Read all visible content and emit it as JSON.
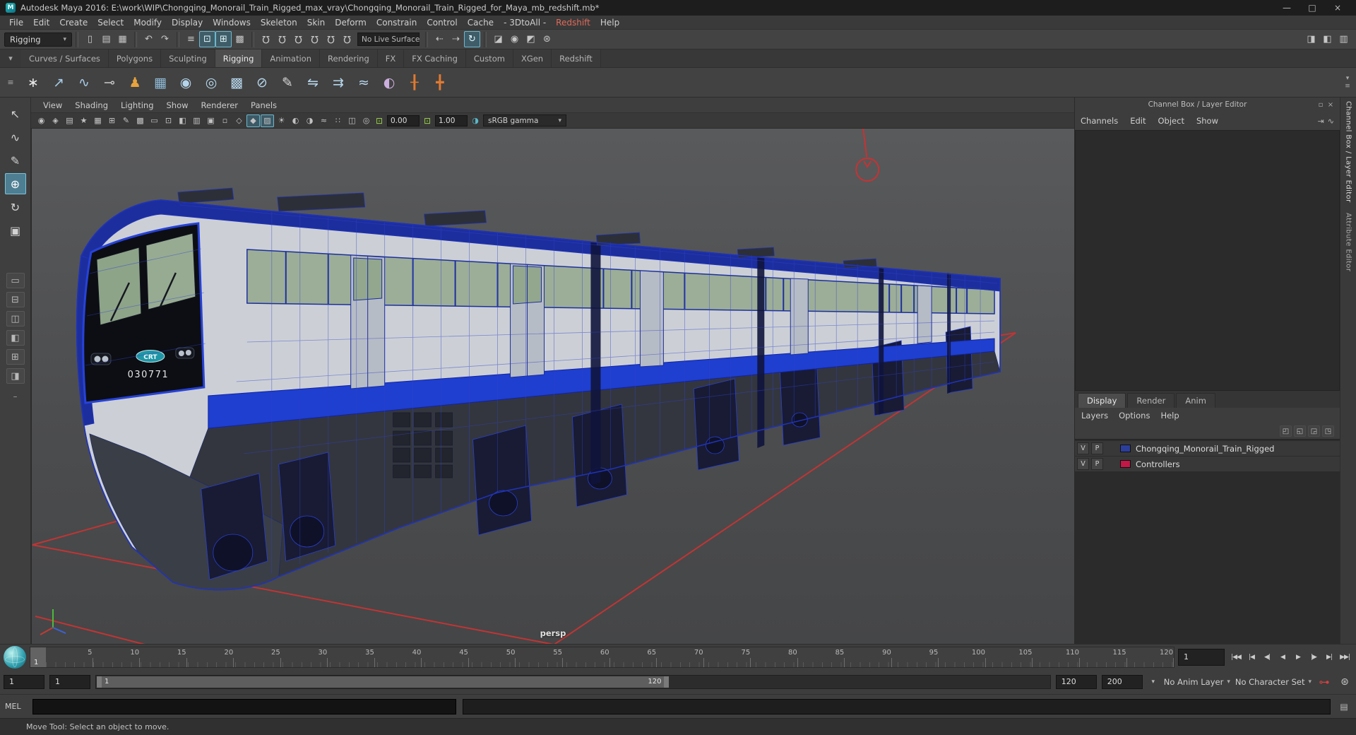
{
  "window": {
    "title": "Autodesk Maya 2016: E:\\work\\WIP\\Chongqing_Monorail_Train_Rigged_max_vray\\Chongqing_Monorail_Train_Rigged_for_Maya_mb_redshift.mb*",
    "logo": "M",
    "minimize": "—",
    "maximize": "□",
    "close": "×"
  },
  "menubar": {
    "items": [
      {
        "label": "File"
      },
      {
        "label": "Edit"
      },
      {
        "label": "Create"
      },
      {
        "label": "Select"
      },
      {
        "label": "Modify"
      },
      {
        "label": "Display"
      },
      {
        "label": "Windows"
      },
      {
        "label": "Skeleton"
      },
      {
        "label": "Skin"
      },
      {
        "label": "Deform"
      },
      {
        "label": "Constrain"
      },
      {
        "label": "Control"
      },
      {
        "label": "Cache"
      },
      {
        "label": "- 3DtoAll -"
      },
      {
        "label": "Redshift",
        "color": "#e06a5a"
      },
      {
        "label": "Help"
      }
    ]
  },
  "toolbar": {
    "menuset": "Rigging",
    "caret": "▾",
    "file_icons": [
      {
        "name": "new-scene-icon",
        "glyph": "▯"
      },
      {
        "name": "open-scene-icon",
        "glyph": "▤"
      },
      {
        "name": "save-scene-icon",
        "glyph": "▦"
      }
    ],
    "undo_icons": [
      {
        "name": "undo-icon",
        "glyph": "↶"
      },
      {
        "name": "redo-icon",
        "glyph": "↷"
      }
    ],
    "select_icons": [
      {
        "name": "select-hierarchy-icon",
        "glyph": "≡"
      },
      {
        "name": "select-object-icon",
        "glyph": "⊡",
        "active": true
      },
      {
        "name": "select-component-icon",
        "glyph": "⊞",
        "active": true
      },
      {
        "name": "select-asset-icon",
        "glyph": "▩"
      }
    ],
    "snap_icons": [
      {
        "name": "snap-to-grid-icon",
        "glyph": "Ω"
      },
      {
        "name": "snap-to-curve-icon",
        "glyph": "Ω"
      },
      {
        "name": "snap-to-point-icon",
        "glyph": "Ω"
      },
      {
        "name": "snap-to-projected-center-icon",
        "glyph": "Ω"
      },
      {
        "name": "snap-to-view-plane-icon",
        "glyph": "Ω"
      },
      {
        "name": "make-live-icon",
        "glyph": "Ω"
      }
    ],
    "live_surface": "No Live Surface",
    "history_icons": [
      {
        "name": "input-connections-icon",
        "glyph": "⇠"
      },
      {
        "name": "output-connections-icon",
        "glyph": "⇢"
      },
      {
        "name": "construction-history-icon",
        "glyph": "↻",
        "active": true
      }
    ],
    "render_icons": [
      {
        "name": "open-render-view-icon",
        "glyph": "◪"
      },
      {
        "name": "render-current-frame-icon",
        "glyph": "◉"
      },
      {
        "name": "ipr-render-icon",
        "glyph": "◩"
      },
      {
        "name": "render-settings-icon",
        "glyph": "⊛"
      }
    ],
    "right_icons": [
      {
        "name": "toggle-attribute-editor-icon",
        "glyph": "◨"
      },
      {
        "name": "toggle-tool-settings-icon",
        "glyph": "◧"
      },
      {
        "name": "toggle-channel-box-icon",
        "glyph": "▥"
      }
    ]
  },
  "shelf": {
    "tab_gadget": "▾",
    "shelf_gadget": "≡",
    "overflow_caret": "▾",
    "editor_gadget": "≡",
    "tabs": [
      {
        "label": "Curves / Surfaces"
      },
      {
        "label": "Polygons"
      },
      {
        "label": "Sculpting"
      },
      {
        "label": "Rigging",
        "active": true
      },
      {
        "label": "Animation"
      },
      {
        "label": "Rendering"
      },
      {
        "label": "FX"
      },
      {
        "label": "FX Caching"
      },
      {
        "label": "Custom"
      },
      {
        "label": "XGen"
      },
      {
        "label": "Redshift"
      }
    ],
    "items": [
      {
        "name": "shelf-joint-tool-icon",
        "glyph": "∗",
        "color": "#e8e8e8"
      },
      {
        "name": "shelf-ik-handle-icon",
        "glyph": "↗",
        "color": "#a8cbe8"
      },
      {
        "name": "shelf-ik-spline-icon",
        "glyph": "∿",
        "color": "#a8cbe8"
      },
      {
        "name": "shelf-insert-joint-icon",
        "glyph": "⊸",
        "color": "#c8c8c8"
      },
      {
        "name": "shelf-quick-rig-icon",
        "glyph": "♟",
        "color": "#e8a33d"
      },
      {
        "name": "shelf-hik-character-icon",
        "glyph": "▦",
        "color": "#8fb9d6"
      },
      {
        "name": "shelf-bind-skin-icon",
        "glyph": "◉",
        "color": "#b5d5ea"
      },
      {
        "name": "shelf-interactive-bind-icon",
        "glyph": "◎",
        "color": "#b5d5ea"
      },
      {
        "name": "shelf-geodesic-bind-icon",
        "glyph": "▩",
        "color": "#b5d5ea"
      },
      {
        "name": "shelf-detach-skin-icon",
        "glyph": "⊘",
        "color": "#b5d5ea"
      },
      {
        "name": "shelf-paint-weights-icon",
        "glyph": "✎",
        "color": "#d8d8d8"
      },
      {
        "name": "shelf-mirror-weights-icon",
        "glyph": "⇋",
        "color": "#b5d5ea"
      },
      {
        "name": "shelf-copy-weights-icon",
        "glyph": "⇉",
        "color": "#b5d5ea"
      },
      {
        "name": "shelf-smooth-weights-icon",
        "glyph": "≈",
        "color": "#b5d5ea"
      },
      {
        "name": "shelf-blend-shape-icon",
        "glyph": "◐",
        "color": "#cbaede"
      },
      {
        "name": "shelf-control-a-icon",
        "glyph": "╂",
        "color": "#e07a30"
      },
      {
        "name": "shelf-control-b-icon",
        "glyph": "╋",
        "color": "#e07a30"
      }
    ]
  },
  "toolbox": {
    "tools": [
      {
        "name": "select-tool-icon",
        "glyph": "↖"
      },
      {
        "name": "lasso-tool-icon",
        "glyph": "∿"
      },
      {
        "name": "paint-select-tool-icon",
        "glyph": "✎"
      },
      {
        "name": "move-tool-icon",
        "glyph": "⊕",
        "active": true
      },
      {
        "name": "rotate-tool-icon",
        "glyph": "↻"
      },
      {
        "name": "scale-tool-icon",
        "glyph": "▣"
      }
    ],
    "layouts": [
      {
        "name": "layout-single-pane-icon",
        "glyph": "▭"
      },
      {
        "name": "layout-two-stacked-icon",
        "glyph": "⊟"
      },
      {
        "name": "layout-two-side-icon",
        "glyph": "◫"
      },
      {
        "name": "layout-three-split-icon",
        "glyph": "◧"
      },
      {
        "name": "layout-four-pane-icon",
        "glyph": "⊞"
      },
      {
        "name": "layout-persp-outliner-icon",
        "glyph": "◨"
      }
    ],
    "dash": "–"
  },
  "viewport": {
    "menus": [
      "View",
      "Shading",
      "Lighting",
      "Show",
      "Renderer",
      "Panels"
    ],
    "icons": [
      {
        "name": "select-camera-icon",
        "glyph": "◉"
      },
      {
        "name": "lock-camera-icon",
        "glyph": "◈"
      },
      {
        "name": "camera-attributes-icon",
        "glyph": "▤"
      },
      {
        "name": "bookmarks-icon",
        "glyph": "★"
      },
      {
        "name": "image-plane-icon",
        "glyph": "▦"
      },
      {
        "name": "two-d-pan-zoom-icon",
        "glyph": "⊞"
      },
      {
        "name": "grease-pencil-icon",
        "glyph": "✎"
      },
      {
        "name": "grid-icon",
        "glyph": "▩"
      },
      {
        "name": "film-gate-icon",
        "glyph": "▭"
      },
      {
        "name": "resolution-gate-icon",
        "glyph": "⊡"
      },
      {
        "name": "gate-mask-icon",
        "glyph": "◧"
      },
      {
        "name": "field-chart-icon",
        "glyph": "▥"
      },
      {
        "name": "safe-action-icon",
        "glyph": "▣"
      },
      {
        "name": "safe-title-icon",
        "glyph": "▫"
      },
      {
        "name": "wireframe-icon",
        "glyph": "◇"
      },
      {
        "name": "shaded-icon",
        "glyph": "◆",
        "active": true
      },
      {
        "name": "textured-icon",
        "glyph": "▨",
        "active": true
      },
      {
        "name": "lights-icon",
        "glyph": "☀"
      },
      {
        "name": "shadows-icon",
        "glyph": "◐"
      },
      {
        "name": "ssao-icon",
        "glyph": "◑"
      },
      {
        "name": "motion-blur-icon",
        "glyph": "≈"
      },
      {
        "name": "multisample-icon",
        "glyph": "∷"
      },
      {
        "name": "xray-icon",
        "glyph": "◫"
      },
      {
        "name": "isolate-select-icon",
        "glyph": "◎"
      }
    ],
    "exposure": "0.00",
    "gamma": "1.00",
    "colorspace": "sRGB gamma",
    "caret": "▾",
    "camera_label": "persp",
    "train_number": "030771",
    "train_logo": "CRT"
  },
  "channel_box": {
    "panel_title": "Channel Box / Layer Editor",
    "float_icon": "▫",
    "close_icon": "×",
    "menus": [
      "Channels",
      "Edit",
      "Object",
      "Show"
    ],
    "corner_icons": [
      {
        "name": "channel-speed-icon",
        "glyph": "⇥"
      },
      {
        "name": "channel-mode-icon",
        "glyph": "∿"
      }
    ]
  },
  "layer_editor": {
    "tabs": [
      {
        "label": "Display",
        "active": true
      },
      {
        "label": "Render"
      },
      {
        "label": "Anim"
      }
    ],
    "menus": [
      "Layers",
      "Options",
      "Help"
    ],
    "icons": [
      {
        "name": "layer-new-empty-icon",
        "glyph": "◰"
      },
      {
        "name": "layer-new-from-selected-icon",
        "glyph": "◱"
      },
      {
        "name": "layer-move-up-icon",
        "glyph": "◲"
      },
      {
        "name": "layer-options-icon",
        "glyph": "◳"
      }
    ],
    "layers": [
      {
        "v": "V",
        "p": "P",
        "color": "#2c3e9b",
        "label": "Chongqing_Monorail_Train_Rigged"
      },
      {
        "v": "V",
        "p": "P",
        "color": "#c21747",
        "label": "Controllers"
      }
    ]
  },
  "dock": {
    "tabs": [
      {
        "label": "Channel Box / Layer Editor",
        "active": true
      },
      {
        "label": "Attribute Editor"
      }
    ]
  },
  "timeline": {
    "current_frame": "1",
    "current_time": "1",
    "ticks": [
      "5",
      "10",
      "15",
      "20",
      "25",
      "30",
      "35",
      "40",
      "45",
      "50",
      "55",
      "60",
      "65",
      "70",
      "75",
      "80",
      "85",
      "90",
      "95",
      "100",
      "105",
      "110",
      "115",
      "120"
    ],
    "playback": [
      {
        "name": "go-to-start-button",
        "glyph": "|◀◀"
      },
      {
        "name": "step-back-key-button",
        "glyph": "|◀"
      },
      {
        "name": "step-back-frame-button",
        "glyph": "◀|"
      },
      {
        "name": "play-backwards-button",
        "glyph": "◀"
      },
      {
        "name": "play-forwards-button",
        "glyph": "▶"
      },
      {
        "name": "step-forward-frame-button",
        "glyph": "|▶"
      },
      {
        "name": "step-forward-key-button",
        "glyph": "▶|"
      },
      {
        "name": "go-to-end-button",
        "glyph": "▶▶|"
      }
    ]
  },
  "range_slider": {
    "anim_start": "1",
    "play_start": "1",
    "bar_start_label": "1",
    "bar_end_label": "120",
    "play_end": "120",
    "anim_end": "200",
    "caret": "▾",
    "anim_layer": "No Anim Layer",
    "character_set": "No Character Set"
  },
  "command_line": {
    "label": "MEL"
  },
  "help_line": {
    "text": "Move Tool: Select an object to move."
  }
}
